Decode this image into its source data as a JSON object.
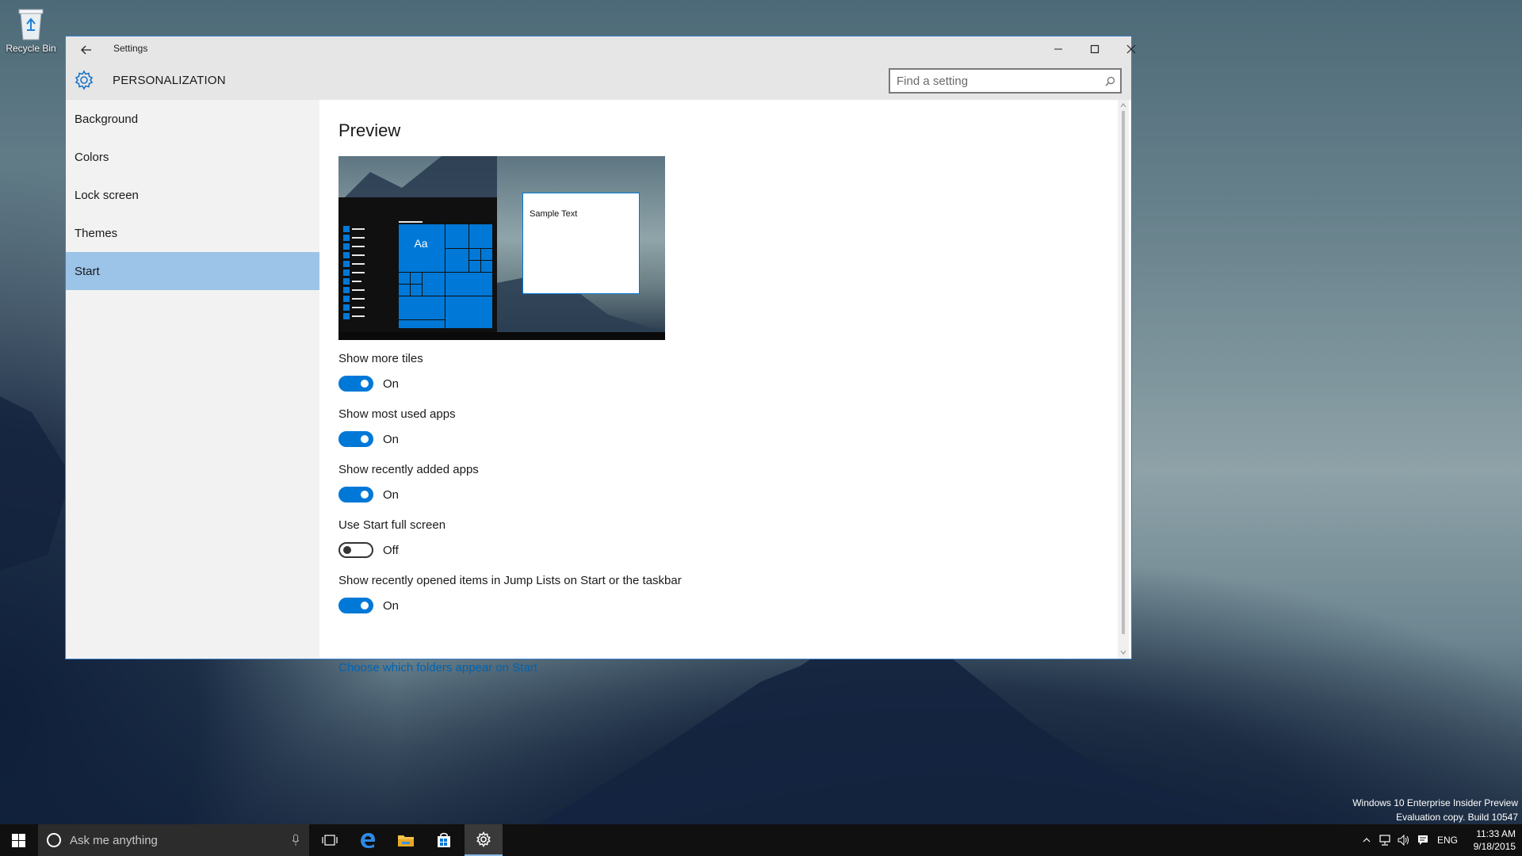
{
  "desktop": {
    "recycle_bin_label": "Recycle Bin",
    "watermark_line1": "Windows 10 Enterprise Insider Preview",
    "watermark_line2": "Evaluation copy. Build 10547"
  },
  "window": {
    "title": "Settings",
    "header_title": "PERSONALIZATION",
    "search_placeholder": "Find a setting",
    "accent_color": "#0078d7",
    "border_color": "#3a7fc8"
  },
  "sidebar": {
    "items": [
      {
        "label": "Background",
        "active": false
      },
      {
        "label": "Colors",
        "active": false
      },
      {
        "label": "Lock screen",
        "active": false
      },
      {
        "label": "Themes",
        "active": false
      },
      {
        "label": "Start",
        "active": true
      }
    ],
    "active_color": "#9cc3e8"
  },
  "main": {
    "preview_heading": "Preview",
    "preview_sample_text": "Sample Text",
    "preview_tile_text": "Aa",
    "settings": [
      {
        "label": "Show more tiles",
        "state": "On"
      },
      {
        "label": "Show most used apps",
        "state": "On"
      },
      {
        "label": "Show recently added apps",
        "state": "On"
      },
      {
        "label": "Use Start full screen",
        "state": "Off"
      },
      {
        "label": "Show recently opened items in Jump Lists on Start or the taskbar",
        "state": "On"
      }
    ],
    "folders_link": "Choose which folders appear on Start"
  },
  "taskbar": {
    "search_placeholder": "Ask me anything",
    "apps": [
      "task-view-icon",
      "edge-icon",
      "file-explorer-icon",
      "store-icon",
      "settings-icon"
    ],
    "active_app": "settings-icon",
    "language": "ENG",
    "time": "11:33 AM",
    "date": "9/18/2015"
  }
}
